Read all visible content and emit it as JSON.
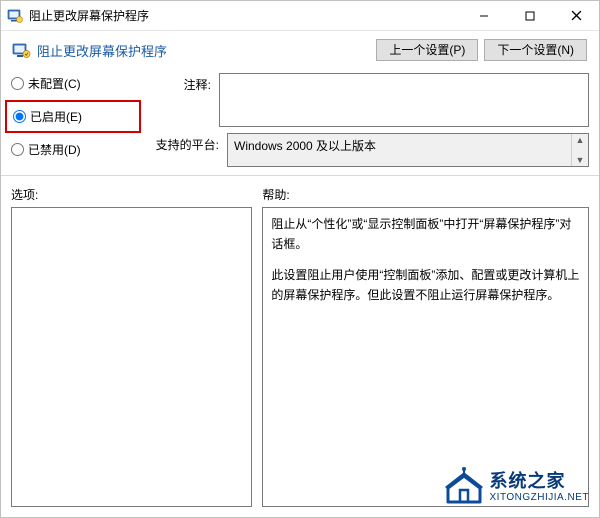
{
  "window": {
    "title": "阻止更改屏幕保护程序"
  },
  "header": {
    "title": "阻止更改屏幕保护程序",
    "prev_button": "上一个设置(P)",
    "next_button": "下一个设置(N)"
  },
  "radios": {
    "not_configured": "未配置(C)",
    "enabled": "已启用(E)",
    "disabled": "已禁用(D)",
    "selected": "enabled"
  },
  "fields": {
    "comment_label": "注释:",
    "comment_value": "",
    "platform_label": "支持的平台:",
    "platform_value": "Windows 2000 及以上版本"
  },
  "panels": {
    "options_label": "选项:",
    "help_label": "帮助:",
    "help_text": {
      "p1": "阻止从“个性化”或“显示控制面板”中打开“屏幕保护程序”对话框。",
      "p2": "此设置阻止用户使用“控制面板”添加、配置或更改计算机上的屏幕保护程序。但此设置不阻止运行屏幕保护程序。"
    }
  },
  "watermark": {
    "cn": "系统之家",
    "en": "XITONGZHIJIA.NET"
  }
}
